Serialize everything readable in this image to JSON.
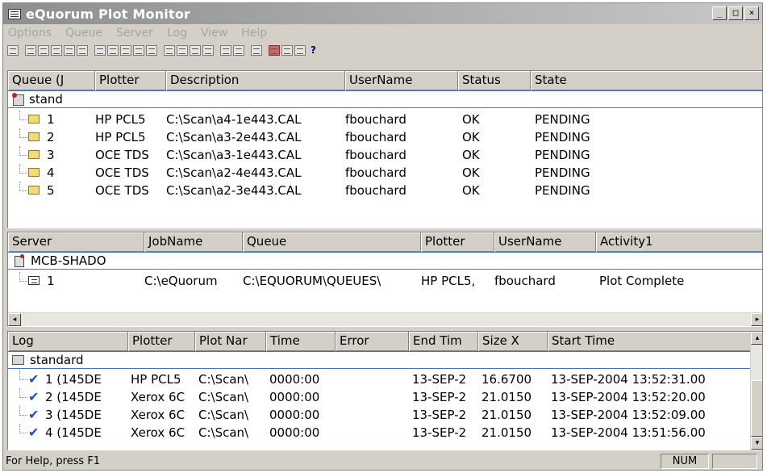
{
  "window": {
    "title": "eQuorum Plot Monitor",
    "minimize": "_",
    "maximize": "□",
    "close": "×"
  },
  "menu": [
    "Options",
    "Queue",
    "Server",
    "Log",
    "View",
    "Help"
  ],
  "toolbar": {
    "help_glyph": "?"
  },
  "queue_pane": {
    "columns": [
      "Queue (J",
      "Plotter",
      "Description",
      "UserName",
      "Status",
      "State"
    ],
    "group": "stand",
    "rows": [
      {
        "id": "1",
        "plotter": "HP PCL5",
        "description": "C:\\Scan\\a4-1e443.CAL",
        "username": "fbouchard",
        "status": "OK",
        "state": "PENDING"
      },
      {
        "id": "2",
        "plotter": "HP PCL5",
        "description": "C:\\Scan\\a3-2e443.CAL",
        "username": "fbouchard",
        "status": "OK",
        "state": "PENDING"
      },
      {
        "id": "3",
        "plotter": "OCE TDS",
        "description": "C:\\Scan\\a3-1e443.CAL",
        "username": "fbouchard",
        "status": "OK",
        "state": "PENDING"
      },
      {
        "id": "4",
        "plotter": "OCE TDS",
        "description": "C:\\Scan\\a2-4e443.CAL",
        "username": "fbouchard",
        "status": "OK",
        "state": "PENDING"
      },
      {
        "id": "5",
        "plotter": "OCE TDS",
        "description": "C:\\Scan\\a2-3e443.CAL",
        "username": "fbouchard",
        "status": "OK",
        "state": "PENDING"
      }
    ]
  },
  "server_pane": {
    "columns": [
      "Server",
      "JobName",
      "Queue",
      "Plotter",
      "UserName",
      "Activity1"
    ],
    "group": "MCB-SHADO",
    "rows": [
      {
        "id": "1",
        "jobname": "C:\\eQuorum",
        "queue": "C:\\EQUORUM\\QUEUES\\",
        "plotter": "HP PCL5,",
        "username": "fbouchard",
        "activity": "Plot Complete"
      }
    ]
  },
  "log_pane": {
    "columns": [
      "Log",
      "Plotter",
      "Plot Nar",
      "Time",
      "Error",
      "End Tim",
      "Size X",
      "Start Time"
    ],
    "group": "standard",
    "rows": [
      {
        "id": "1 (145DE",
        "plotter": "HP PCL5",
        "plotname": "C:\\Scan\\",
        "time": "0000:00",
        "error": "",
        "endtime": "13-SEP-2",
        "sizex": "16.6700",
        "starttime": "13-SEP-2004 13:52:31.00"
      },
      {
        "id": "2 (145DE",
        "plotter": "Xerox 6C",
        "plotname": "C:\\Scan\\",
        "time": "0000:00",
        "error": "",
        "endtime": "13-SEP-2",
        "sizex": "21.0150",
        "starttime": "13-SEP-2004 13:52:20.00"
      },
      {
        "id": "3 (145DE",
        "plotter": "Xerox 6C",
        "plotname": "C:\\Scan\\",
        "time": "0000:00",
        "error": "",
        "endtime": "13-SEP-2",
        "sizex": "21.0150",
        "starttime": "13-SEP-2004 13:52:09.00"
      },
      {
        "id": "4 (145DE",
        "plotter": "Xerox 6C",
        "plotname": "C:\\Scan\\",
        "time": "0000:00",
        "error": "",
        "endtime": "13-SEP-2",
        "sizex": "21.0150",
        "starttime": "13-SEP-2004 13:51:56.00"
      }
    ]
  },
  "statusbar": {
    "help_text": "For Help, press F1",
    "num_indicator": "NUM"
  }
}
